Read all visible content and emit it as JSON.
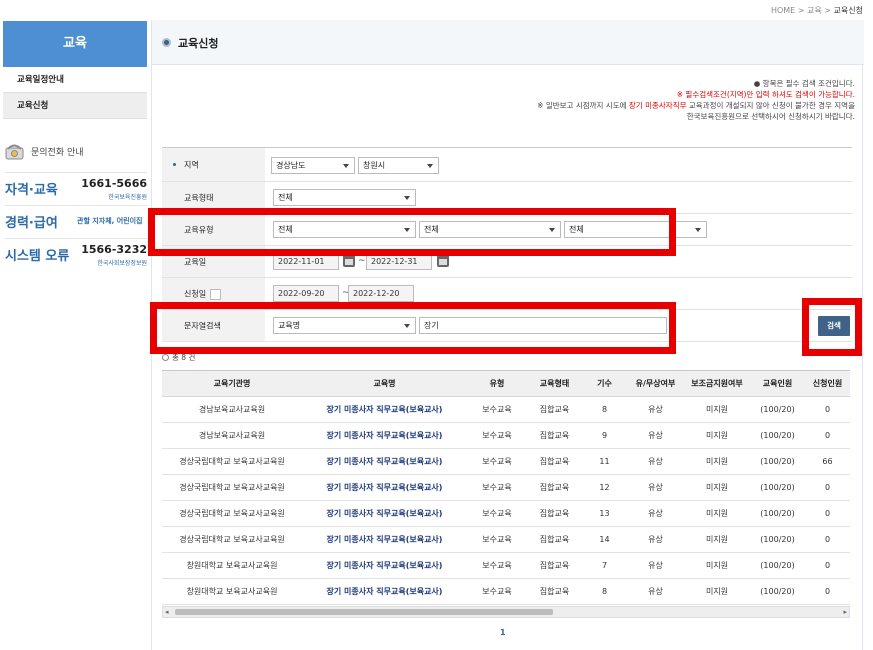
{
  "breadcrumb": {
    "home": "HOME",
    "sep": ">",
    "level1": "교육",
    "current": "교육신청"
  },
  "sidebar": {
    "title": "교육",
    "items": [
      {
        "label": "교육일정안내",
        "active": false
      },
      {
        "label": "교육신청",
        "active": true
      }
    ],
    "contact_heading": "문의전화 안내",
    "contacts": [
      {
        "label": "자격·교육",
        "number": "1661-5666",
        "org": "한국보육진흥원"
      },
      {
        "label": "경력·급여",
        "note": "관할 지자체, 어린이집"
      },
      {
        "label": "시스템 오류",
        "number": "1566-3232",
        "org": "한국사회보장정보원"
      }
    ]
  },
  "page": {
    "title": "교육신청"
  },
  "notice": {
    "line1": "● 항목은 필수 검색 조건입니다.",
    "line2": "※ 필수검색조건(지역)만 입력 하셔도 검색이 가능합니다.",
    "line3_pre": "※ 일반보고 시점까지 시도에 ",
    "line3_red": "장기 미종사자직무",
    "line3_post": " 교육과정이 개설되지 않아 신청이 불가한 경우 지역을",
    "line4": "한국보육진흥원으로 선택하시어 신청하시기 바랍니다."
  },
  "form": {
    "region": {
      "label": "지역",
      "province": "경상남도",
      "city": "창원시"
    },
    "edu_form": {
      "label": "교육형태",
      "value": "전체"
    },
    "edu_type": {
      "label": "교육유형",
      "v1": "전체",
      "v2": "전체",
      "v3": "전체"
    },
    "edu_date": {
      "label": "교육일",
      "from": "2022-11-01",
      "to": "2022-12-31",
      "sep": "~"
    },
    "apply_date": {
      "label": "신청일",
      "from": "2022-09-20",
      "to": "2022-12-20",
      "sep": "~"
    },
    "keyword": {
      "label": "문자열검색",
      "field": "교육명",
      "value": "장기"
    },
    "search_button": "검색"
  },
  "result_count": "총 8 건",
  "table": {
    "headers": [
      "교육기관명",
      "교육명",
      "유형",
      "교육형태",
      "기수",
      "유/무상여부",
      "보조금지원여부",
      "교육인원",
      "신청인원"
    ],
    "rows": [
      [
        "경남보육교사교육원",
        "장기 미종사자 직무교육(보육교사)",
        "보수교육",
        "집합교육",
        "8",
        "유상",
        "미지원",
        "(100/20)",
        "0"
      ],
      [
        "경남보육교사교육원",
        "장기 미종사자 직무교육(보육교사)",
        "보수교육",
        "집합교육",
        "9",
        "유상",
        "미지원",
        "(100/20)",
        "0"
      ],
      [
        "경상국립대학교 보육교사교육원",
        "장기 미종사자 직무교육(보육교사)",
        "보수교육",
        "집합교육",
        "11",
        "유상",
        "미지원",
        "(100/20)",
        "66"
      ],
      [
        "경상국립대학교 보육교사교육원",
        "장기 미종사자 직무교육(보육교사)",
        "보수교육",
        "집합교육",
        "12",
        "유상",
        "미지원",
        "(100/20)",
        "0"
      ],
      [
        "경상국립대학교 보육교사교육원",
        "장기 미종사자 직무교육(보육교사)",
        "보수교육",
        "집합교육",
        "13",
        "유상",
        "미지원",
        "(100/20)",
        "0"
      ],
      [
        "경상국립대학교 보육교사교육원",
        "장기 미종사자 직무교육(보육교사)",
        "보수교육",
        "집합교육",
        "14",
        "유상",
        "미지원",
        "(100/20)",
        "0"
      ],
      [
        "창원대학교 보육교사교육원",
        "장기 미종사자 직무교육(보육교사)",
        "보수교육",
        "집합교육",
        "7",
        "유상",
        "미지원",
        "(100/20)",
        "0"
      ],
      [
        "창원대학교 보육교사교육원",
        "장기 미종사자 직무교육(보육교사)",
        "보수교육",
        "집합교육",
        "8",
        "유상",
        "미지원",
        "(100/20)",
        "0"
      ]
    ]
  },
  "pagination": {
    "current": "1"
  },
  "colors": {
    "accent": "#4e8fd3",
    "highlight": "#e60000",
    "button": "#3f6289",
    "course_text": "#1f3a78"
  }
}
